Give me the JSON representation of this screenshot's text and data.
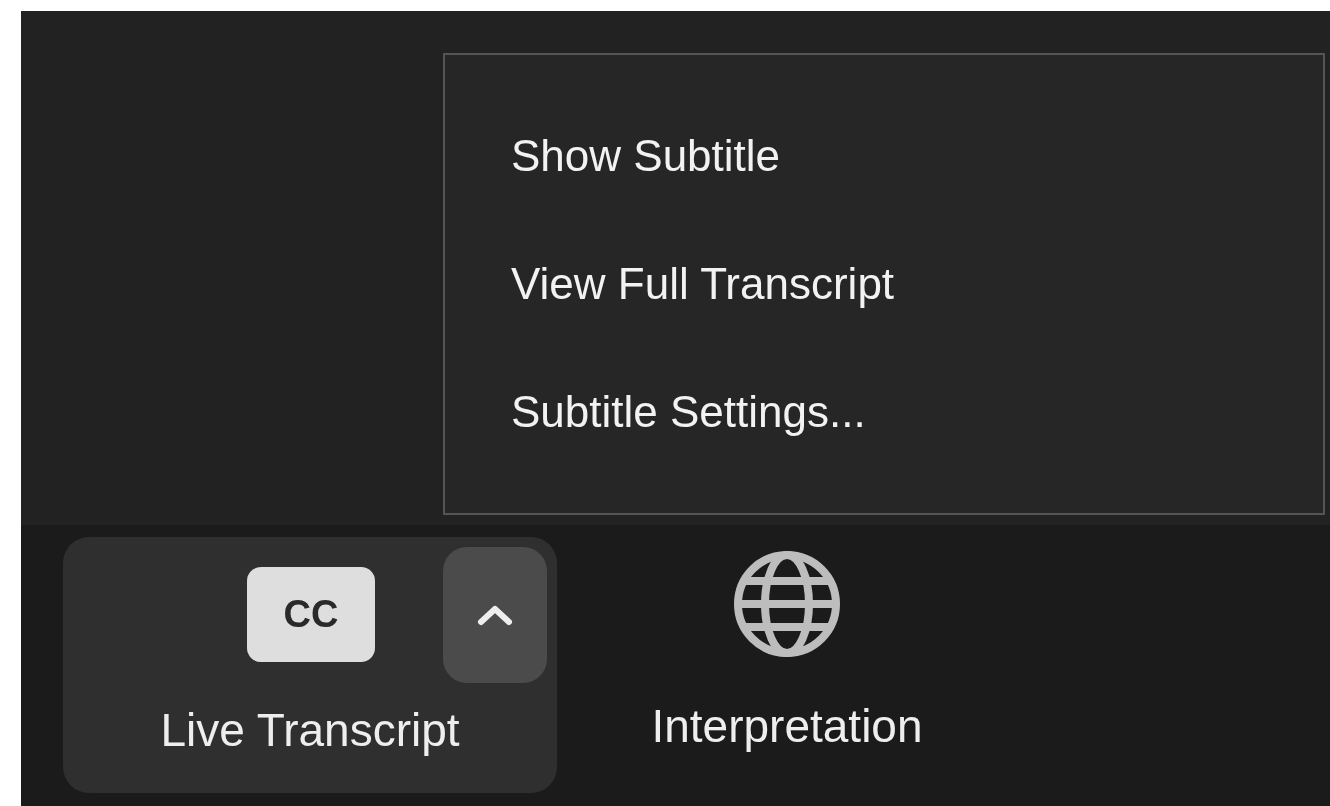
{
  "menu": {
    "items": [
      {
        "label": "Show Subtitle"
      },
      {
        "label": "View Full Transcript"
      },
      {
        "label": "Subtitle Settings..."
      }
    ]
  },
  "toolbar": {
    "items": [
      {
        "kind": "cc",
        "icon_text": "CC",
        "label": "Live Transcript",
        "expanded": true
      },
      {
        "kind": "globe",
        "label": "Interpretation"
      }
    ]
  }
}
